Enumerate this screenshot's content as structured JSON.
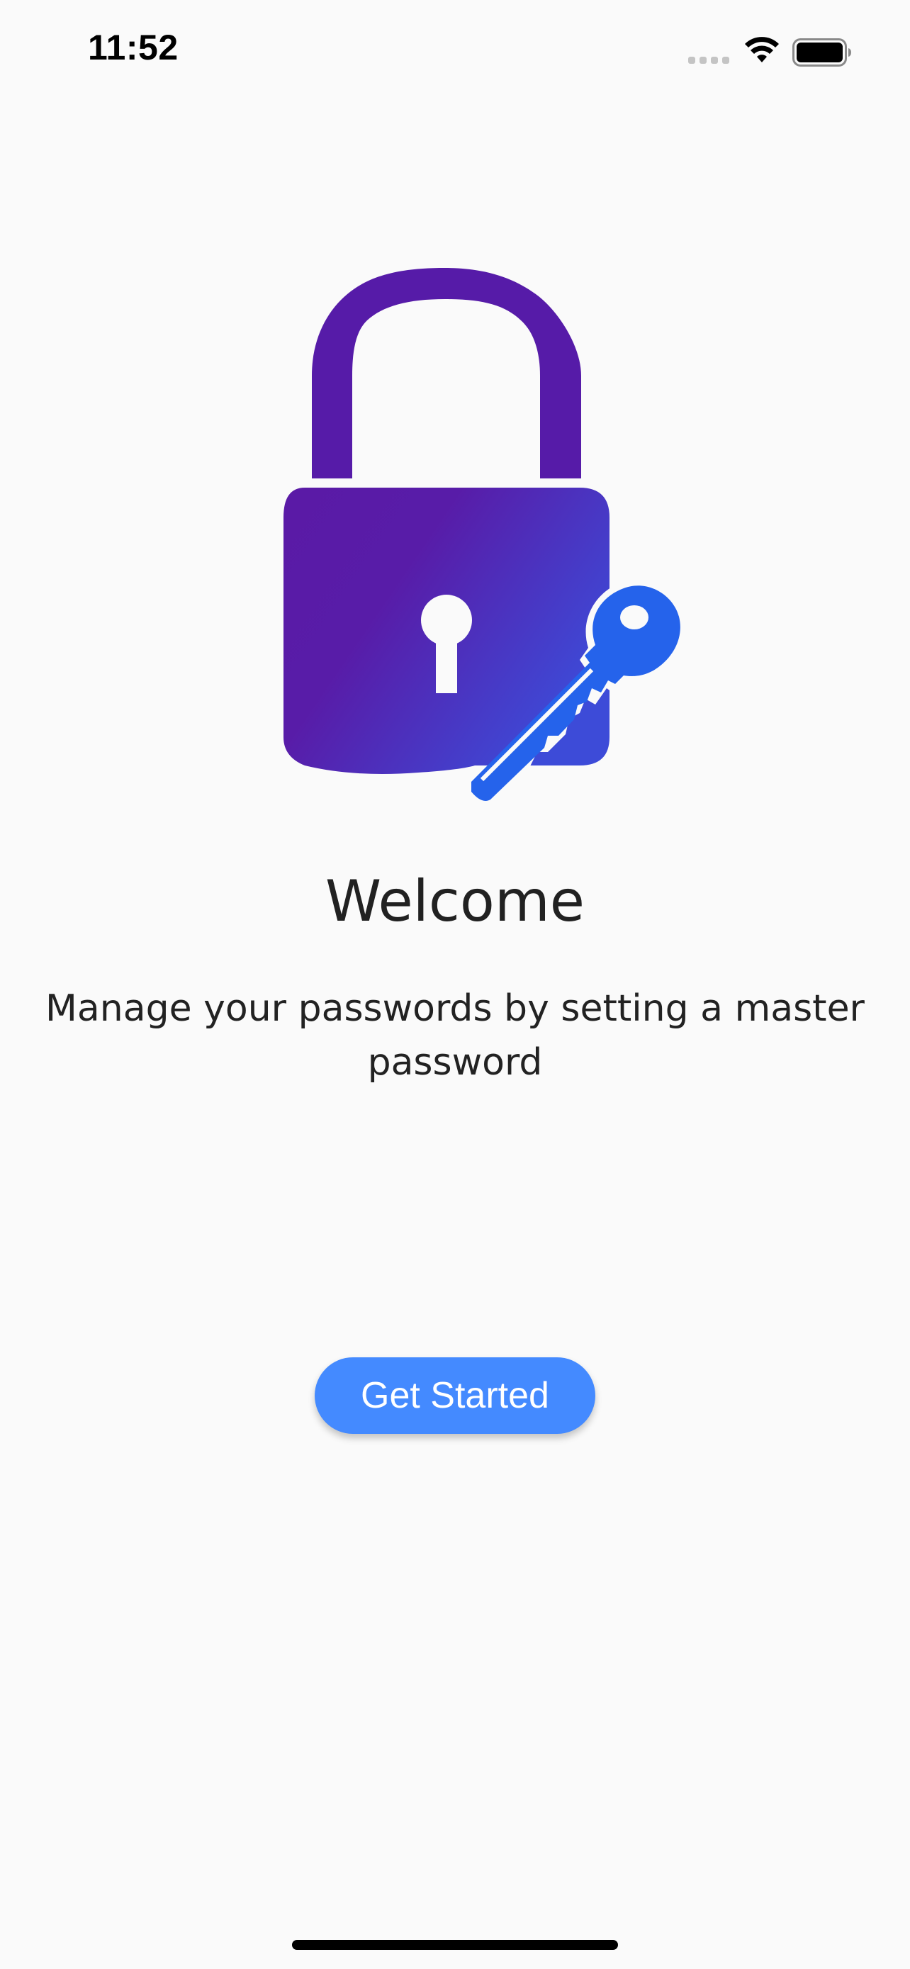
{
  "status_bar": {
    "time": "11:52",
    "icons": [
      "cellular-signal-icon",
      "wifi-icon",
      "battery-icon"
    ]
  },
  "illustration": {
    "icons": [
      "padlock-icon",
      "key-icon"
    ],
    "colors": {
      "lock_gradient_start": "#5a1aa6",
      "lock_gradient_end": "#3f45d4",
      "key": "#2563eb"
    }
  },
  "welcome": {
    "title": "Welcome",
    "subtitle": "Manage your passwords by setting a master password"
  },
  "actions": {
    "get_started_label": "Get Started"
  },
  "theme": {
    "background": "#fafafa",
    "primary_button": "#448aff",
    "text": "#212121"
  }
}
